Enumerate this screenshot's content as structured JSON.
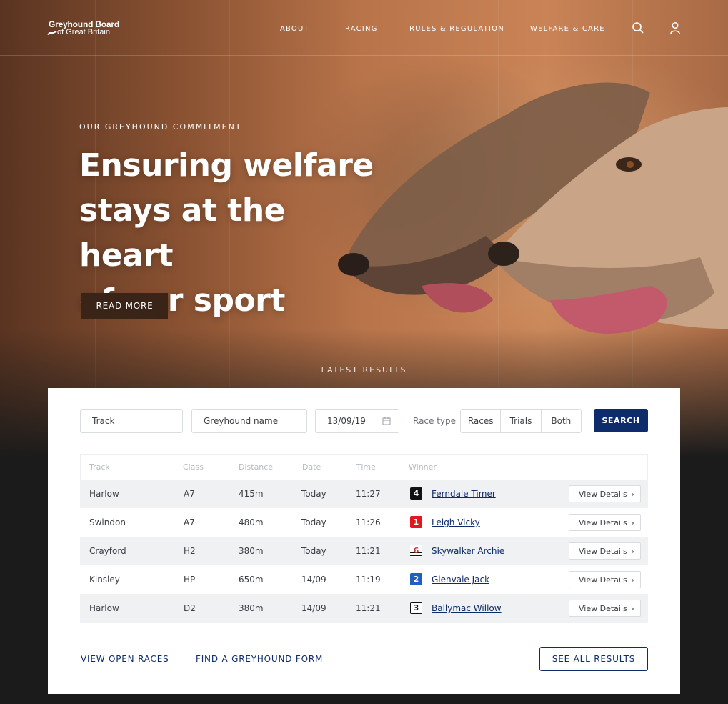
{
  "brand": {
    "line1": "Greyhound Board",
    "line2": "of Great Britain"
  },
  "nav": {
    "items": [
      "ABOUT",
      "RACING",
      "RULES & REGULATION",
      "WELFARE & CARE"
    ]
  },
  "hero": {
    "eyebrow": "OUR GREYHOUND COMMITMENT",
    "headline_1": "Ensuring welfare",
    "headline_2": "stays at the heart",
    "headline_3": "of our sport",
    "cta": "READ MORE"
  },
  "results": {
    "section_label": "LATEST RESULTS",
    "filters": {
      "track_placeholder": "Track",
      "greyhound_placeholder": "Greyhound name",
      "date_value": "13/09/19",
      "race_type_label": "Race type",
      "race_types": [
        "Races",
        "Trials",
        "Both"
      ],
      "search_label": "SEARCH"
    },
    "columns": [
      "Track",
      "Class",
      "Distance",
      "Date",
      "Time",
      "Winner"
    ],
    "rows": [
      {
        "track": "Harlow",
        "class": "A7",
        "distance": "415m",
        "date": "Today",
        "time": "11:27",
        "trap": "4",
        "winner": "Ferndale Timer",
        "action": "View Details"
      },
      {
        "track": "Swindon",
        "class": "A7",
        "distance": "480m",
        "date": "Today",
        "time": "11:26",
        "trap": "1",
        "winner": "Leigh Vicky",
        "action": "View Details"
      },
      {
        "track": "Crayford",
        "class": "H2",
        "distance": "380m",
        "date": "Today",
        "time": "11:21",
        "trap": "6",
        "winner": "Skywalker Archie",
        "action": "View Details"
      },
      {
        "track": "Kinsley",
        "class": "HP",
        "distance": "650m",
        "date": "14/09",
        "time": "11:19",
        "trap": "2",
        "winner": "Glenvale Jack",
        "action": "View Details"
      },
      {
        "track": "Harlow",
        "class": "D2",
        "distance": "380m",
        "date": "14/09",
        "time": "11:21",
        "trap": "3",
        "winner": "Ballymac Willow",
        "action": "View Details"
      }
    ],
    "footer": {
      "open_races": "VIEW OPEN RACES",
      "form": "FIND A GREYHOUND FORM",
      "see_all": "SEE ALL RESULTS"
    }
  },
  "colors": {
    "brand_navy": "#0e2b6b",
    "cta_brown": "#3a2317",
    "trap1": "#e3171f",
    "trap2": "#1f5fbf",
    "trap3": "#ffffff",
    "trap4": "#111111",
    "trap6": "#ffffff"
  },
  "icons": {
    "search": "search-icon",
    "account": "user-icon",
    "calendar": "calendar-icon"
  }
}
